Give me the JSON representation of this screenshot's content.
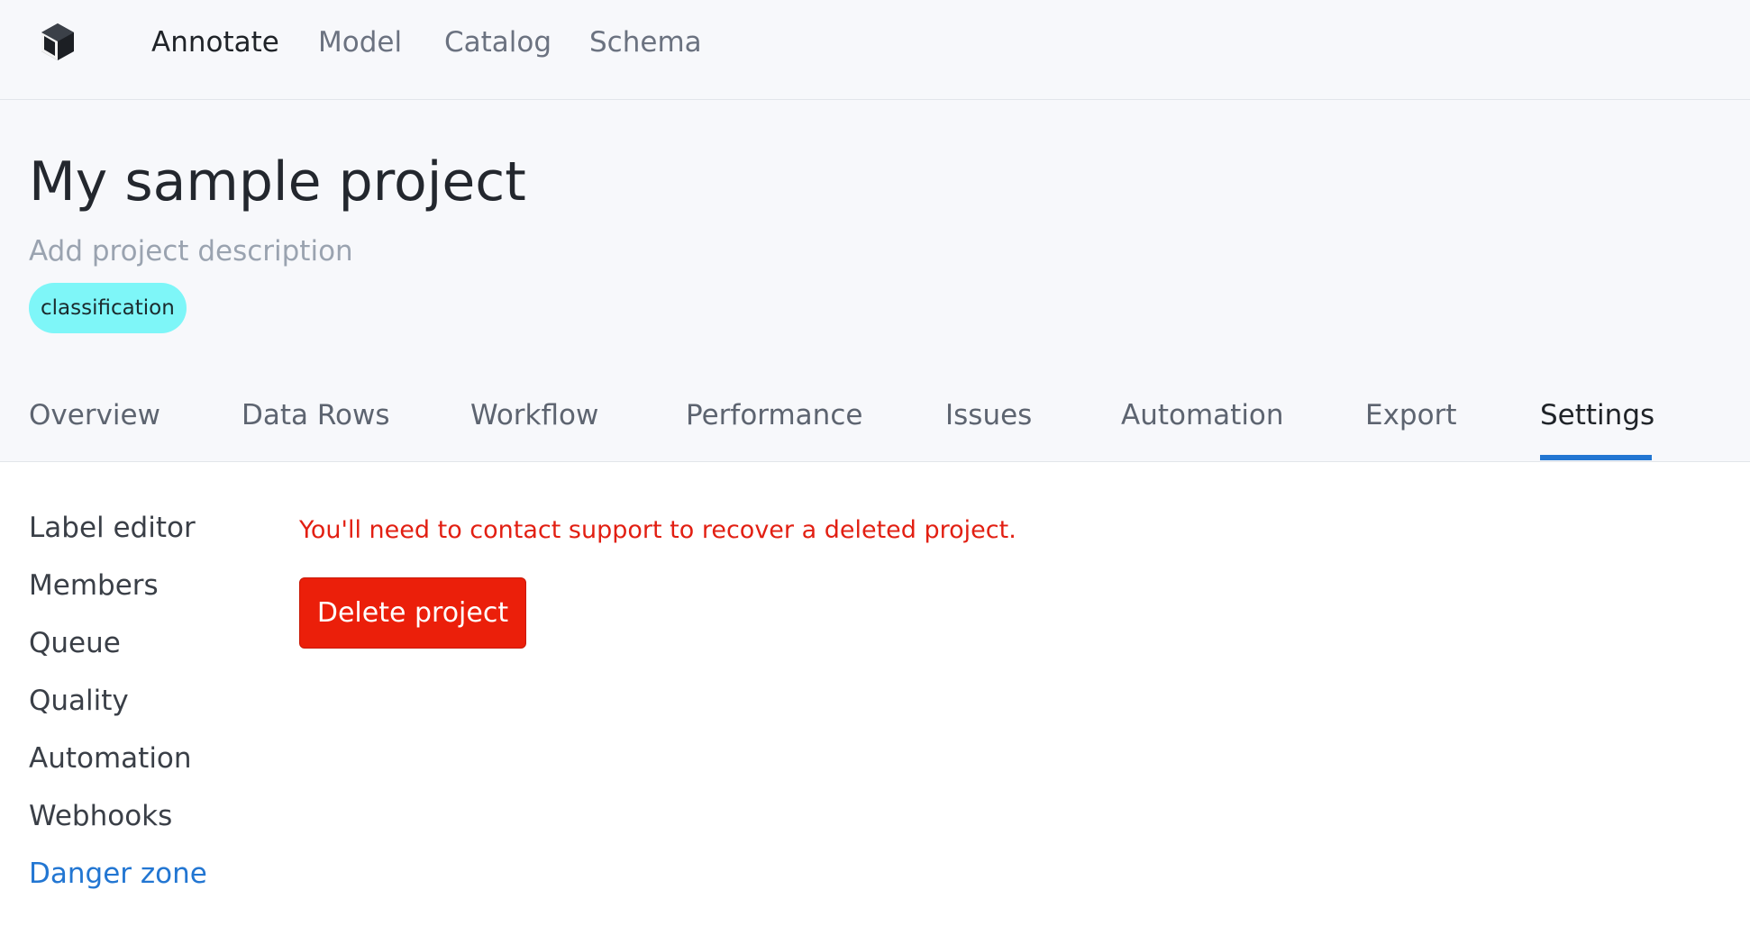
{
  "topnav": {
    "logo_icon": "cube-logo-icon",
    "items": [
      {
        "label": "Annotate",
        "active": true
      },
      {
        "label": "Model",
        "active": false
      },
      {
        "label": "Catalog",
        "active": false
      },
      {
        "label": "Schema",
        "active": false
      }
    ]
  },
  "project": {
    "title": "My sample project",
    "description_placeholder": "Add project description",
    "tag": "classification"
  },
  "tabs": [
    {
      "label": "Overview",
      "active": false
    },
    {
      "label": "Data Rows",
      "active": false
    },
    {
      "label": "Workflow",
      "active": false
    },
    {
      "label": "Performance",
      "active": false
    },
    {
      "label": "Issues",
      "active": false
    },
    {
      "label": "Automation",
      "active": false
    },
    {
      "label": "Export",
      "active": false
    },
    {
      "label": "Settings",
      "active": true
    }
  ],
  "settings_nav": [
    {
      "label": "Label editor",
      "active": false
    },
    {
      "label": "Members",
      "active": false
    },
    {
      "label": "Queue",
      "active": false
    },
    {
      "label": "Quality",
      "active": false
    },
    {
      "label": "Automation",
      "active": false
    },
    {
      "label": "Webhooks",
      "active": false
    },
    {
      "label": "Danger zone",
      "active": true
    }
  ],
  "danger_zone": {
    "warning": "You'll need to contact support to recover a deleted project.",
    "delete_label": "Delete project"
  },
  "colors": {
    "accent": "#2276d2",
    "danger": "#eb1f0a",
    "tag_bg": "#7ef6f8"
  }
}
